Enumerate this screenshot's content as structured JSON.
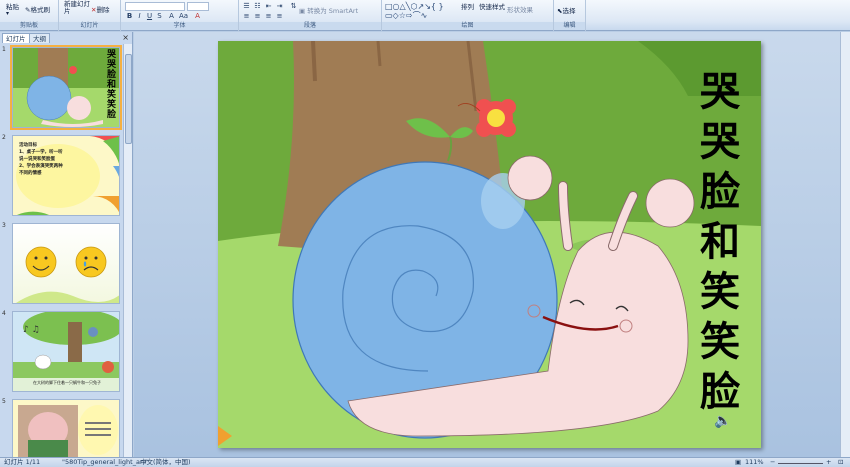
{
  "ribbon": {
    "groups": [
      {
        "label": "剪贴板"
      },
      {
        "label": "幻灯片"
      },
      {
        "label": "字体"
      },
      {
        "label": "段落"
      },
      {
        "label": "绘图"
      },
      {
        "label": "编辑"
      }
    ],
    "paste_label": "粘贴",
    "format_painter_label": "格式刷",
    "new_slide_label": "新建幻灯片",
    "delete_label": "删除",
    "convert_smartart_label": "转换为 SmartArt",
    "arrange_label": "排列",
    "quick_styles_label": "快速样式",
    "shape_effects_label": "形状效果",
    "select_label": "选择"
  },
  "left_panel": {
    "tab_slides": "幻灯片",
    "tab_outline": "大纲",
    "close": "×",
    "thumbnails": [
      {
        "num": "1",
        "title": "哭哭脸和笑笑脸"
      },
      {
        "num": "2",
        "lines": [
          "活动目标",
          "1、桌子一学，听一听",
          "说一说哭和笑脸蛋",
          "2、学会表演哭笑两种",
          "不同的情感"
        ]
      },
      {
        "num": "3"
      },
      {
        "num": "4",
        "caption": "在大树的脚下住着一只蜗牛和一只兔子"
      },
      {
        "num": "5"
      }
    ]
  },
  "slide": {
    "title": "哭哭脸和笑笑脸"
  },
  "status": {
    "slide_info": "幻灯片 1/11",
    "theme": "\"580Tip_general_light_ani\"",
    "language": "中文(简体，中国)",
    "zoom": "111%"
  },
  "colors": {
    "slide_bg_top": "#6eaa3c",
    "grass": "#a5d96b",
    "trunk": "#a07c54",
    "shell": "#7fb4e6",
    "snail_body": "#f8dede"
  }
}
